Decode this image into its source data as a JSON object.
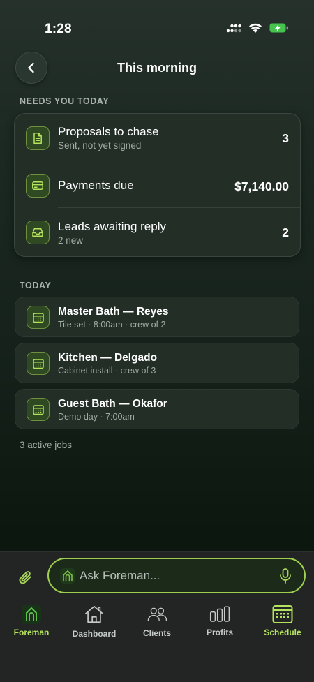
{
  "status_bar": {
    "time": "1:28"
  },
  "header": {
    "title": "This morning"
  },
  "needs_section": {
    "label": "NEEDS YOU TODAY",
    "rows": [
      {
        "icon": "document-icon",
        "title": "Proposals to chase",
        "subtitle": "Sent, not yet signed",
        "value": "3"
      },
      {
        "icon": "credit-card-icon",
        "title": "Payments due",
        "subtitle": "",
        "value": "$7,140.00"
      },
      {
        "icon": "inbox-icon",
        "title": "Leads awaiting reply",
        "subtitle": "2 new",
        "value": "2"
      }
    ]
  },
  "today_section": {
    "label": "TODAY",
    "jobs": [
      {
        "icon": "calendar-icon",
        "title": "Master Bath — Reyes",
        "subtitle": "Tile set · 8:00am · crew of 2"
      },
      {
        "icon": "calendar-icon",
        "title": "Kitchen — Delgado",
        "subtitle": "Cabinet install · crew of 3"
      },
      {
        "icon": "calendar-icon",
        "title": "Guest Bath — Okafor",
        "subtitle": "Demo day · 7:00am"
      }
    ],
    "footer": "3 active jobs"
  },
  "composer": {
    "placeholder": "Ask Foreman...",
    "value": ""
  },
  "tabs": [
    {
      "label": "Foreman",
      "icon": "foreman-logo-icon",
      "active": true
    },
    {
      "label": "Dashboard",
      "icon": "house-icon",
      "active": false
    },
    {
      "label": "Clients",
      "icon": "people-icon",
      "active": false
    },
    {
      "label": "Profits",
      "icon": "bar-chart-icon",
      "active": false
    },
    {
      "label": "Schedule",
      "icon": "calendar-icon",
      "active": true
    }
  ],
  "colors": {
    "accent": "#b6e35d",
    "accent_border": "#9fcf4f",
    "card_bg": "#232e27",
    "background_top": "#25312a",
    "background_bottom": "#0b140e"
  }
}
